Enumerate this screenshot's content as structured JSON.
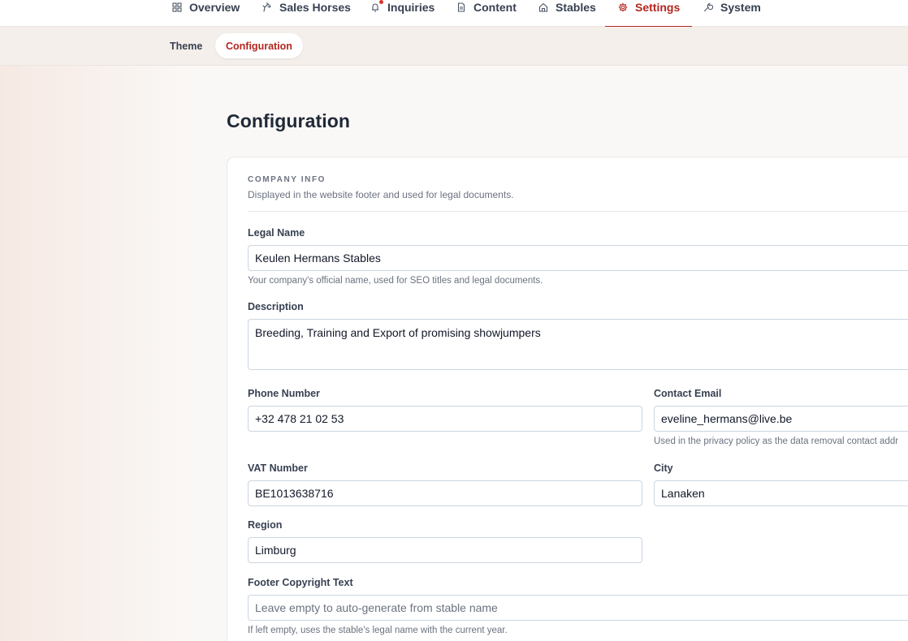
{
  "nav": {
    "items": [
      {
        "label": "Overview"
      },
      {
        "label": "Sales Horses"
      },
      {
        "label": "Inquiries"
      },
      {
        "label": "Content"
      },
      {
        "label": "Stables"
      },
      {
        "label": "Settings"
      },
      {
        "label": "System"
      }
    ],
    "active": "Settings"
  },
  "subnav": {
    "tabs": [
      {
        "label": "Theme"
      },
      {
        "label": "Configuration"
      }
    ],
    "active": "Configuration"
  },
  "page": {
    "title": "Configuration"
  },
  "section": {
    "title": "COMPANY INFO",
    "description": "Displayed in the website footer and used for legal documents."
  },
  "fields": {
    "legal_name": {
      "label": "Legal Name",
      "value": "Keulen Hermans Stables",
      "help": "Your company's official name, used for SEO titles and legal documents."
    },
    "description": {
      "label": "Description",
      "value": "Breeding, Training and Export of promising showjumpers"
    },
    "phone": {
      "label": "Phone Number",
      "value": "+32 478 21 02 53"
    },
    "contact_email": {
      "label": "Contact Email",
      "value": "eveline_hermans@live.be",
      "help": "Used in the privacy policy as the data removal contact addr"
    },
    "vat": {
      "label": "VAT Number",
      "value": "BE1013638716"
    },
    "city": {
      "label": "City",
      "value": "Lanaken"
    },
    "region": {
      "label": "Region",
      "value": "Limburg"
    },
    "footer_copyright": {
      "label": "Footer Copyright Text",
      "value": "",
      "placeholder": "Leave empty to auto-generate from stable name",
      "help": "If left empty, uses the stable's legal name with the current year."
    }
  },
  "colors": {
    "accent": "#b3261e",
    "notification_dot": "#d9342b"
  }
}
